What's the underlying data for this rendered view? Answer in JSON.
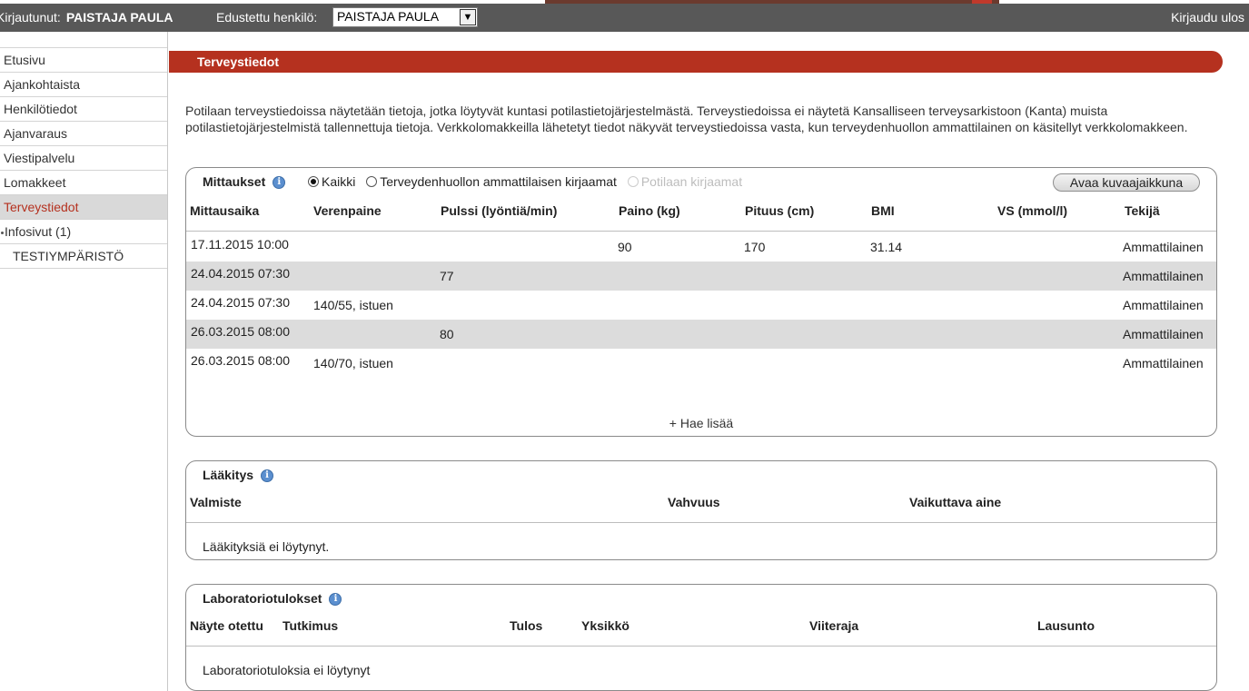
{
  "topbar": {
    "logged_label": "Kirjautunut:",
    "user": "PAISTAJA PAULA",
    "represented_label": "Edustettu henkilö:",
    "represented_value": "PAISTAJA PAULA",
    "logout": "Kirjaudu ulos"
  },
  "sidebar": {
    "items": [
      {
        "label": "Etusivu"
      },
      {
        "label": "Ajankohtaista"
      },
      {
        "label": "Henkilötiedot"
      },
      {
        "label": "Ajanvaraus"
      },
      {
        "label": "Viestipalvelu"
      },
      {
        "label": "Lomakkeet"
      },
      {
        "label": "Terveystiedot"
      },
      {
        "label": "Infosivut (1)"
      },
      {
        "label": "TESTIYMPÄRISTÖ"
      }
    ]
  },
  "section": {
    "title": "Terveystiedot",
    "intro": "Potilaan terveystiedoissa näytetään tietoja, jotka löytyvät kuntasi potilastietojärjestelmästä. Terveystiedoissa ei näytetä Kansalliseen terveysarkistoon (Kanta) muista potilastietojärjestelmistä tallennettuja tietoja. Verkkolomakkeilla lähetetyt tiedot näkyvät terveystiedoissa vasta, kun terveydenhuollon ammattilainen on käsitellyt verkkolomakkeen."
  },
  "measurements": {
    "title": "Mittaukset",
    "filters": {
      "all": "Kaikki",
      "professional": "Terveydenhuollon ammattilaisen kirjaamat",
      "patient": "Potilaan kirjaamat",
      "selected": "Kaikki"
    },
    "graph_button": "Avaa kuvaajaikkuna",
    "columns": [
      "Mittausaika",
      "Verenpaine",
      "Pulssi (lyöntiä/min)",
      "Paino (kg)",
      "Pituus (cm)",
      "BMI",
      "VS (mmol/l)",
      "Tekijä"
    ],
    "rows": [
      [
        "17.11.2015 10:00",
        "",
        "",
        "90",
        "170",
        "31.14",
        "",
        "Ammattilainen"
      ],
      [
        "24.04.2015 07:30",
        "",
        "77",
        "",
        "",
        "",
        "",
        "Ammattilainen"
      ],
      [
        "24.04.2015 07:30",
        "140/55, istuen",
        "",
        "",
        "",
        "",
        "",
        "Ammattilainen"
      ],
      [
        "26.03.2015 08:00",
        "",
        "80",
        "",
        "",
        "",
        "",
        "Ammattilainen"
      ],
      [
        "26.03.2015 08:00",
        "140/70, istuen",
        "",
        "",
        "",
        "",
        "",
        "Ammattilainen"
      ]
    ],
    "more": "+ Hae lisää"
  },
  "medication": {
    "title": "Lääkitys",
    "columns": [
      "Valmiste",
      "Vahvuus",
      "Vaikuttava aine"
    ],
    "empty": "Lääkityksiä ei löytynyt."
  },
  "lab": {
    "title": "Laboratoriotulokset",
    "columns": [
      "Näyte otettu",
      "Tutkimus",
      "Tulos",
      "Yksikkö",
      "Viiteraja",
      "Lausunto"
    ],
    "empty": "Laboratoriotuloksia ei löytynyt"
  }
}
